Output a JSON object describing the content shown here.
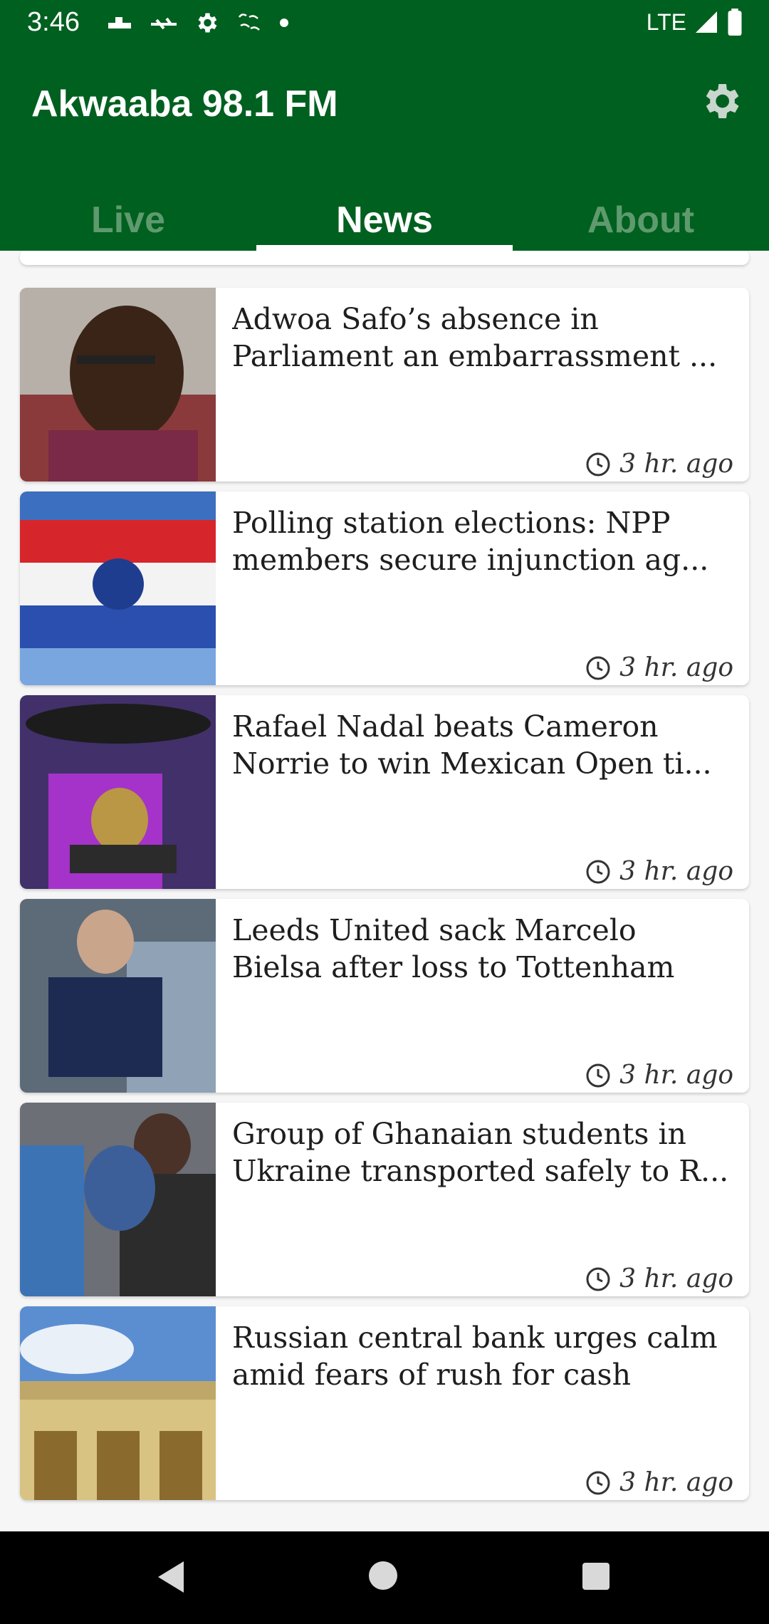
{
  "status_bar": {
    "time": "3:46",
    "network": "LTE",
    "icons": [
      "notification-icon",
      "notification-icon",
      "gear-icon",
      "radio-icon",
      "dot-icon"
    ]
  },
  "app_bar": {
    "title": "Akwaaba 98.1 FM",
    "settings_icon": "gear-icon"
  },
  "tabs": [
    {
      "label": "Live",
      "active": false
    },
    {
      "label": "News",
      "active": true
    },
    {
      "label": "About",
      "active": false
    }
  ],
  "news": [
    {
      "title": "Adwoa Safo’s absence in Parliament an embarrassment ...",
      "time": "3 hr. ago"
    },
    {
      "title": "Polling station elections: NPP members secure injunction ag...",
      "time": "3 hr. ago"
    },
    {
      "title": "Rafael Nadal beats Cameron Norrie to win Mexican Open ti...",
      "time": "3 hr. ago"
    },
    {
      "title": "Leeds United sack Marcelo Bielsa after loss to Tottenham",
      "time": "3 hr. ago"
    },
    {
      "title": "Group of Ghanaian students in Ukraine transported safely to R...",
      "time": "3 hr. ago"
    },
    {
      "title": "Russian central bank urges calm amid fears of rush for cash",
      "time": "3 hr. ago"
    }
  ],
  "colors": {
    "brand": "#00601f",
    "tab_inactive": "#5f9a6f"
  }
}
